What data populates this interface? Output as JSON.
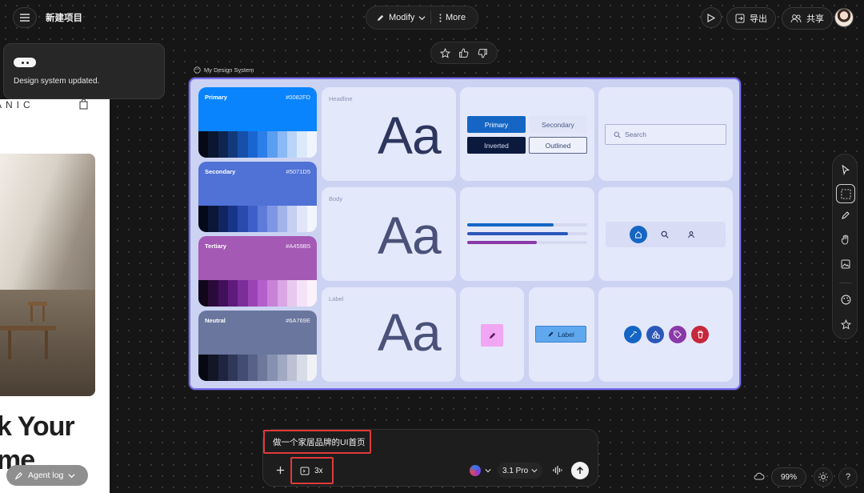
{
  "header": {
    "project_title": "新建项目",
    "modify_label": "Modify",
    "more_label": "More",
    "export_label": "导出",
    "share_label": "共享"
  },
  "toast": {
    "message": "Design system updated."
  },
  "preview": {
    "brand_fragment": "ANIC",
    "heading_line1": "k Your",
    "heading_line2": "me",
    "agent_log_label": "Agent log"
  },
  "board": {
    "name": "My Design System",
    "colors": [
      {
        "name": "Primary",
        "hex": "#0082FD",
        "main": "#0a84fd",
        "shades": [
          "#050a16",
          "#0b1630",
          "#0f2550",
          "#123a7a",
          "#1650a8",
          "#1a66d0",
          "#2c7fe8",
          "#5a9ef0",
          "#8ab9f5",
          "#b9d4f8",
          "#dce9fb",
          "#f0f5fd"
        ]
      },
      {
        "name": "Secondary",
        "hex": "#5071D5",
        "main": "#5071d5",
        "shades": [
          "#050a1a",
          "#0b1638",
          "#112560",
          "#173588",
          "#2a4aae",
          "#3e5fc8",
          "#5f7bda",
          "#7f96e2",
          "#a2b3ea",
          "#c4cff2",
          "#e0e6f8",
          "#f2f5fc"
        ]
      },
      {
        "name": "Tertiary",
        "hex": "#A459B5",
        "main": "#a459b5",
        "shades": [
          "#12061a",
          "#2a0a3a",
          "#420f5a",
          "#5e1a7c",
          "#7c2d9a",
          "#9a43b4",
          "#b45fcc",
          "#c882d8",
          "#daa6e4",
          "#e9c8ef",
          "#f4e2f7",
          "#fbf3fc"
        ]
      },
      {
        "name": "Neutral",
        "hex": "#6A769E",
        "main": "#6a769e",
        "shades": [
          "#070912",
          "#121626",
          "#1f2540",
          "#30385a",
          "#434c72",
          "#586288",
          "#6e789c",
          "#8690b0",
          "#a0a8c2",
          "#bcc2d4",
          "#d8dce6",
          "#eff1f6"
        ]
      }
    ],
    "type_labels": {
      "headline": "Headline",
      "body": "Body",
      "label": "Label"
    },
    "aa": "Aa",
    "buttons": {
      "primary": "Primary",
      "secondary": "Secondary",
      "inverted": "Inverted",
      "outlined": "Outlined"
    },
    "search_placeholder": "Search",
    "chip_label": "Label",
    "progress": [
      0.72,
      0.84,
      0.58
    ]
  },
  "composer": {
    "prompt_text": "做一个家居品牌的UI首页",
    "multiplier": "3x",
    "model": "3.1 Pro"
  },
  "footer": {
    "zoom": "99%",
    "help": "?"
  }
}
